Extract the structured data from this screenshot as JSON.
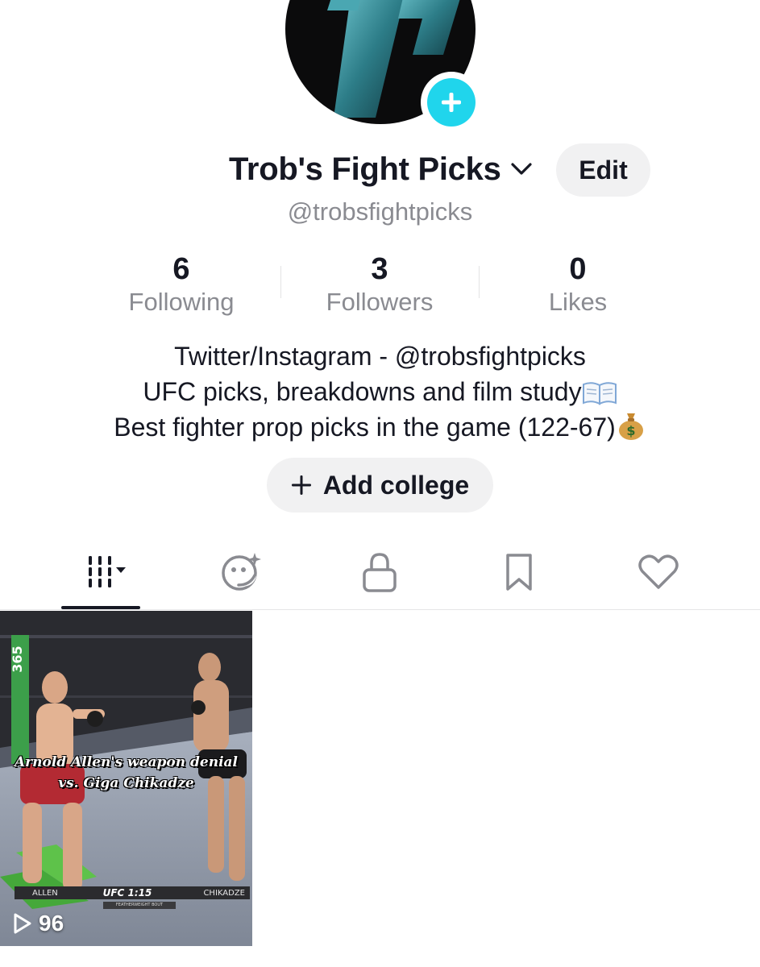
{
  "profile": {
    "display_name": "Trob's Fight Picks",
    "handle": "@trobsfightpicks",
    "edit_label": "Edit",
    "avatar_icon": "tp-logo",
    "add_avatar_icon": "plus-icon"
  },
  "stats": {
    "following_count": "6",
    "following_label": "Following",
    "followers_count": "3",
    "followers_label": "Followers",
    "likes_count": "0",
    "likes_label": "Likes"
  },
  "bio": {
    "line1": "Twitter/Instagram - @trobsfightpicks",
    "line2": "UFC picks, breakdowns and film study",
    "line3": "Best fighter prop picks in the game (122-67)"
  },
  "college_button": {
    "label": "Add college",
    "icon": "plus-icon"
  },
  "tabs": [
    {
      "name": "videos",
      "icon": "grid-icon",
      "selected": true
    },
    {
      "name": "reposts",
      "icon": "face-sparkle-icon"
    },
    {
      "name": "private",
      "icon": "lock-icon"
    },
    {
      "name": "favorites",
      "icon": "bookmark-icon"
    },
    {
      "name": "liked",
      "icon": "heart-icon"
    }
  ],
  "videos": [
    {
      "caption_line1": "Arnold Allen's weapon denial",
      "caption_line2": "vs. Giga Chikadze",
      "score_left": "ALLEN",
      "score_mid": "UFC 1:15",
      "score_right": "CHIKADZE",
      "bout_label": "FEATHERWEIGHT BOUT",
      "views": "96",
      "play_icon": "play-icon"
    }
  ],
  "colors": {
    "accent_cyan": "#20d5ec",
    "text_primary": "#161823",
    "text_secondary": "#8a8b91",
    "button_bg": "#f1f1f2"
  }
}
